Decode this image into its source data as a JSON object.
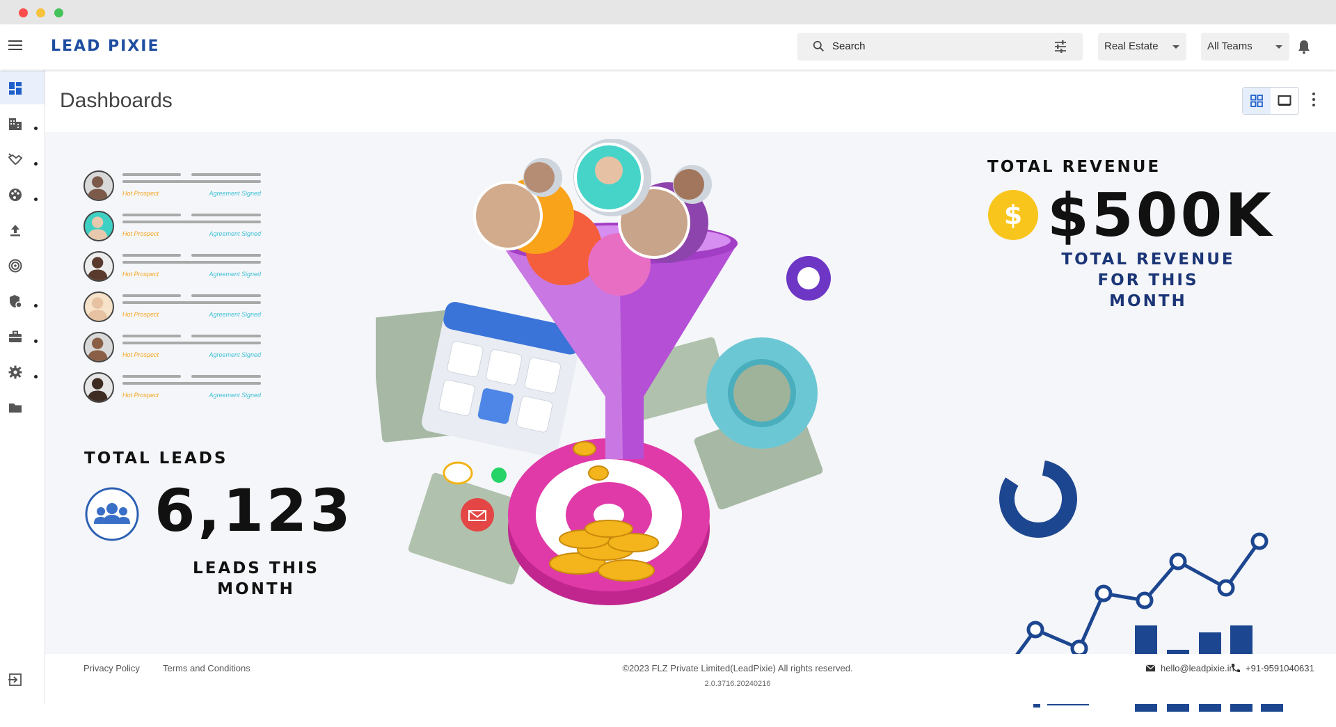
{
  "app": {
    "logo_text": "LEAD PIXIE"
  },
  "topbar": {
    "search_placeholder": "Search",
    "industry_select": "Real Estate",
    "team_select": "All Teams"
  },
  "sidebar": {
    "items": [
      {
        "icon": "dashboard-icon",
        "active": true,
        "has_submenu": false
      },
      {
        "icon": "building-icon",
        "active": false,
        "has_submenu": true
      },
      {
        "icon": "handshake-icon",
        "active": false,
        "has_submenu": true
      },
      {
        "icon": "palette-icon",
        "active": false,
        "has_submenu": true
      },
      {
        "icon": "upload-icon",
        "active": false,
        "has_submenu": false
      },
      {
        "icon": "target-icon",
        "active": false,
        "has_submenu": false
      },
      {
        "icon": "shield-settings-icon",
        "active": false,
        "has_submenu": true
      },
      {
        "icon": "briefcase-icon",
        "active": false,
        "has_submenu": true
      },
      {
        "icon": "gear-icon",
        "active": false,
        "has_submenu": true
      },
      {
        "icon": "folder-icon",
        "active": false,
        "has_submenu": false
      }
    ]
  },
  "page": {
    "title": "Dashboards"
  },
  "leads_list": {
    "rows": [
      {
        "tag1": "Hot Prospect",
        "tag2": "Agreement Signed"
      },
      {
        "tag1": "Hot Prospect",
        "tag2": "Agreement Signed"
      },
      {
        "tag1": "Hot Prospect",
        "tag2": "Agreement Signed"
      },
      {
        "tag1": "Hot Prospect",
        "tag2": "Agreement Signed"
      },
      {
        "tag1": "Hot Prospect",
        "tag2": "Agreement Signed"
      },
      {
        "tag1": "Hot Prospect",
        "tag2": "Agreement Signed"
      }
    ]
  },
  "total_leads": {
    "title": "TOTAL LEADS",
    "value": "6,123",
    "subtitle_line1": "LEADS THIS",
    "subtitle_line2": "MONTH"
  },
  "total_revenue": {
    "title": "TOTAL REVENUE",
    "value": "$500K",
    "subtitle_line1": "TOTAL REVENUE",
    "subtitle_line2": "FOR THIS MONTH"
  },
  "footer": {
    "privacy": "Privacy Policy",
    "terms": "Terms and Conditions",
    "copyright": "©2023 FLZ Private Limited(LeadPixie) All rights reserved.",
    "version": "2.0.3716.20240216",
    "email": "hello@leadpixie.in",
    "phone": "+91-9591040631"
  },
  "colors": {
    "brand_blue": "#1f4ea1",
    "accent_orange": "#f5a623",
    "accent_teal": "#3fc1d6",
    "funnel_purple": "#b44fd6",
    "target_pink": "#e03aa8",
    "chart_navy": "#1d4690"
  }
}
